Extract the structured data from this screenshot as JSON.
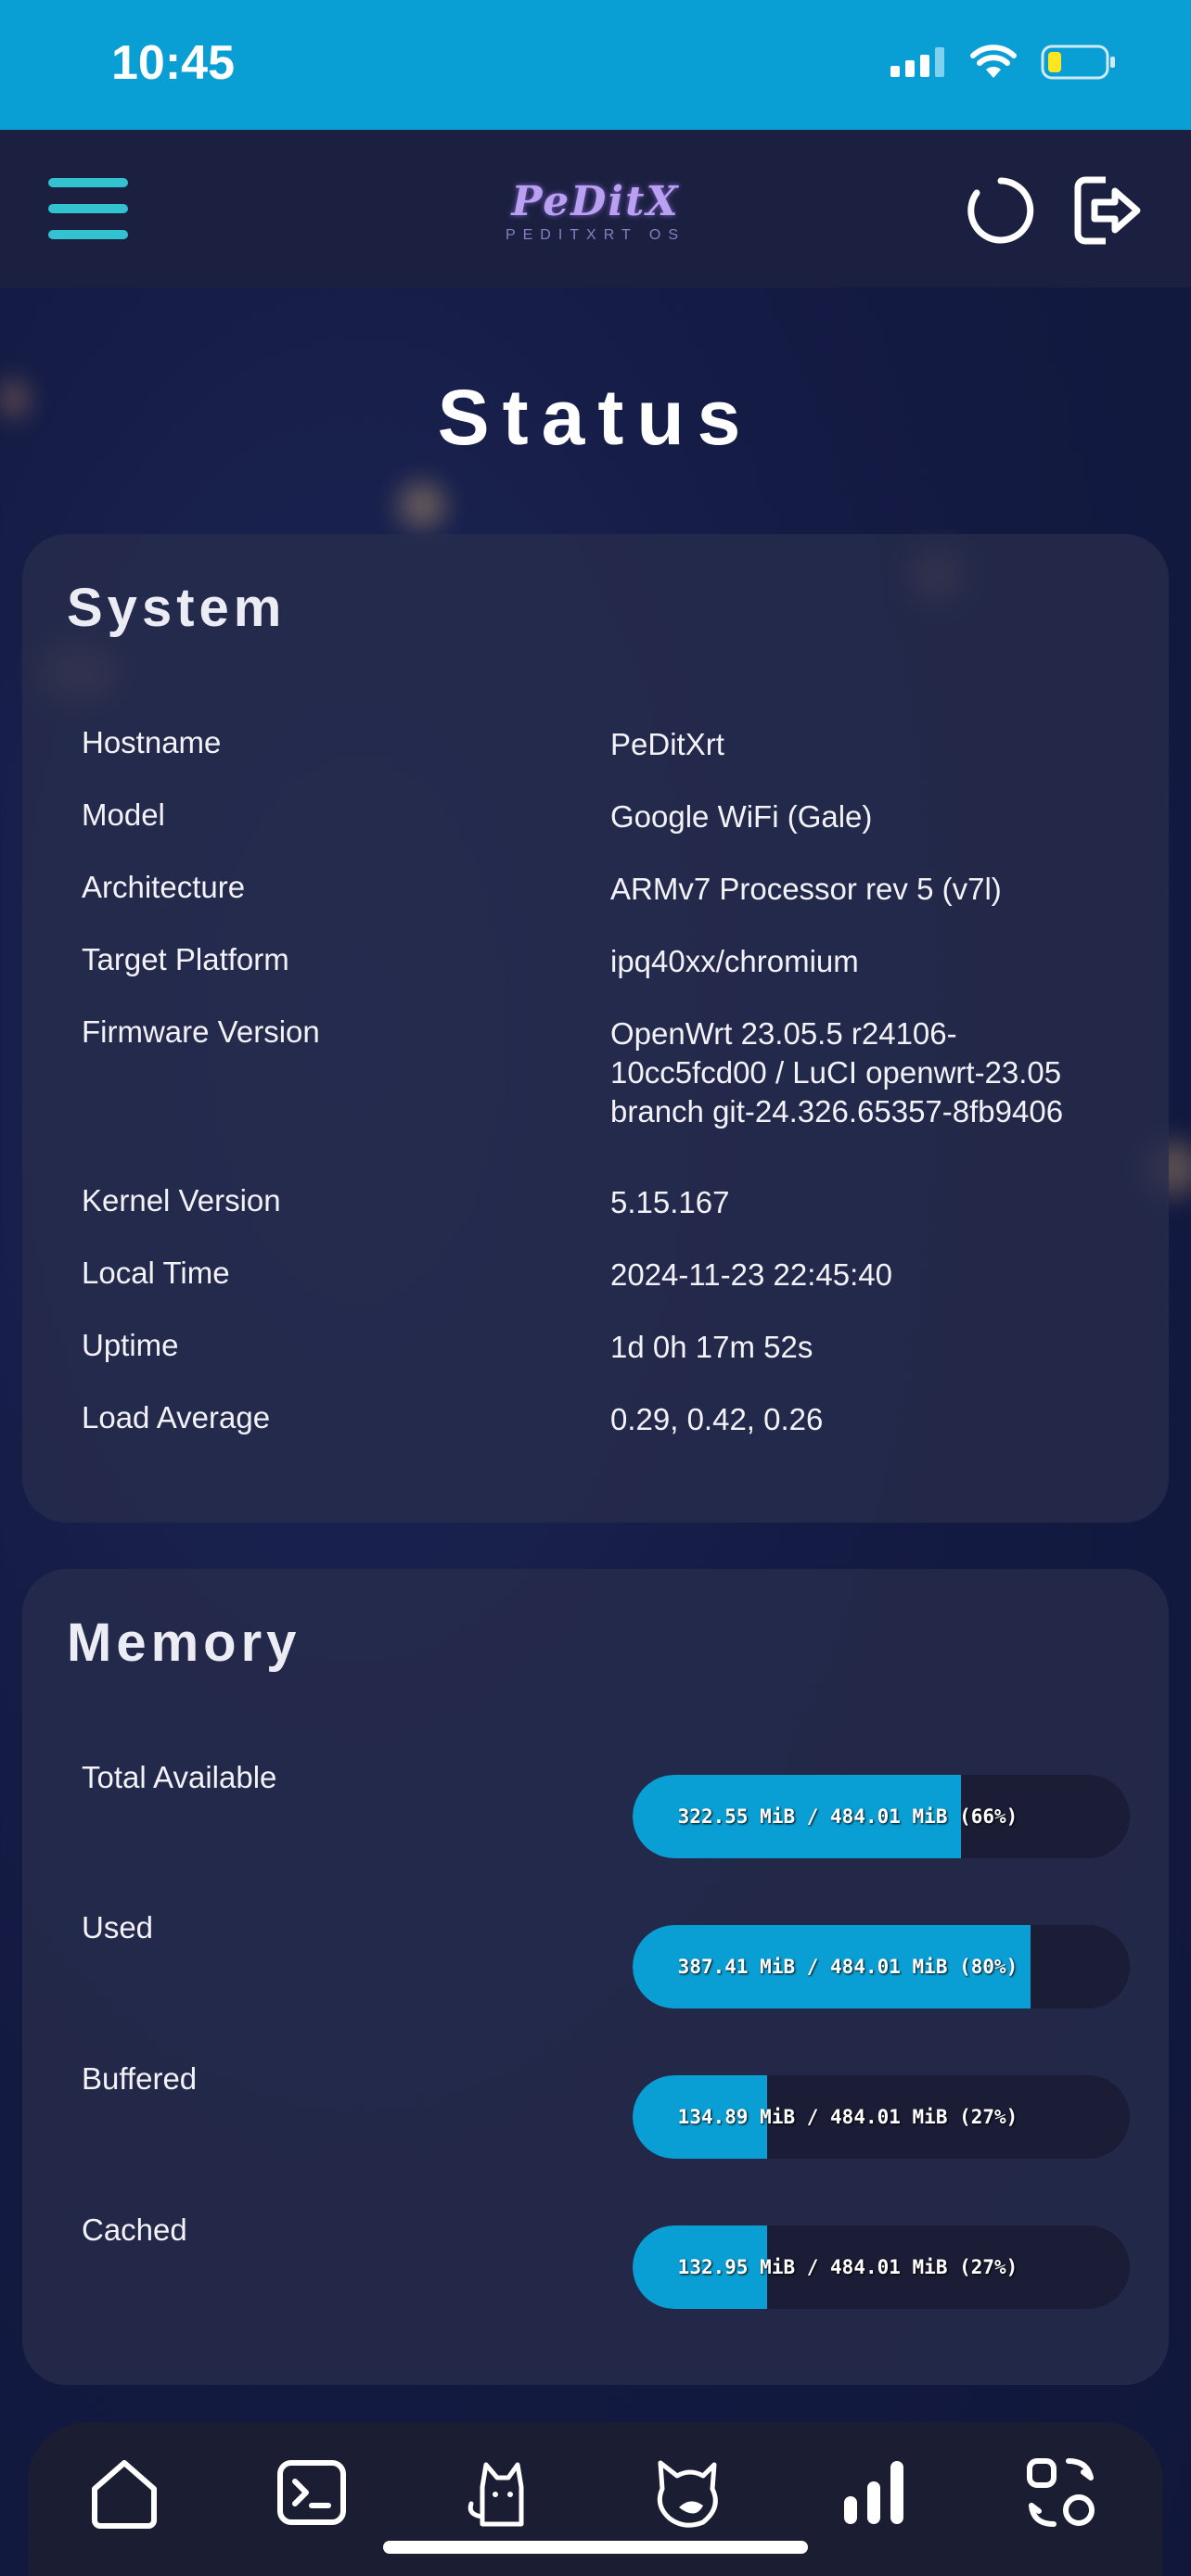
{
  "statusbar": {
    "time": "10:45",
    "icons": [
      "cellular-signal-icon",
      "wifi-icon",
      "battery-low-icon"
    ],
    "color": "#0a9fd4"
  },
  "header": {
    "logo_text": "PeDitX",
    "logo_subtitle": "PEDITXRT OS",
    "icons": [
      "menu-icon",
      "refresh-icon",
      "logout-icon"
    ]
  },
  "page": {
    "title": "Status"
  },
  "system": {
    "title": "System",
    "rows": [
      {
        "label": "Hostname",
        "value": "PeDitXrt"
      },
      {
        "label": "Model",
        "value": "Google WiFi (Gale)"
      },
      {
        "label": "Architecture",
        "value": "ARMv7 Processor rev 5 (v7l)"
      },
      {
        "label": "Target Platform",
        "value": "ipq40xx/chromium"
      },
      {
        "label": "Firmware Version",
        "value": "OpenWrt 23.05.5 r24106-10cc5fcd00 / LuCI openwrt-23.05 branch git-24.326.65357-8fb9406"
      },
      {
        "label": "Kernel Version",
        "value": "5.15.167"
      },
      {
        "label": "Local Time",
        "value": "2024-11-23 22:45:40"
      },
      {
        "label": "Uptime",
        "value": "1d 0h 17m 52s"
      },
      {
        "label": "Load Average",
        "value": "0.29, 0.42, 0.26"
      }
    ]
  },
  "memory": {
    "title": "Memory",
    "rows": [
      {
        "label": "Total Available",
        "text": "322.55 MiB / 484.01 MiB (66%)",
        "percent": 66
      },
      {
        "label": "Used",
        "text": "387.41 MiB / 484.01 MiB (80%)",
        "percent": 80
      },
      {
        "label": "Buffered",
        "text": "134.89 MiB / 484.01 MiB (27%)",
        "percent": 27
      },
      {
        "label": "Cached",
        "text": "132.95 MiB / 484.01 MiB (27%)",
        "percent": 27
      }
    ]
  },
  "bottom_nav": {
    "items": [
      "home-icon",
      "terminal-icon",
      "cat-icon",
      "fox-icon",
      "bar-chart-icon",
      "apps-icon"
    ]
  },
  "colors": {
    "accent": "#0a9fd4",
    "menu": "#32c2d0",
    "background": "#141b44",
    "card": "#282d4b"
  }
}
